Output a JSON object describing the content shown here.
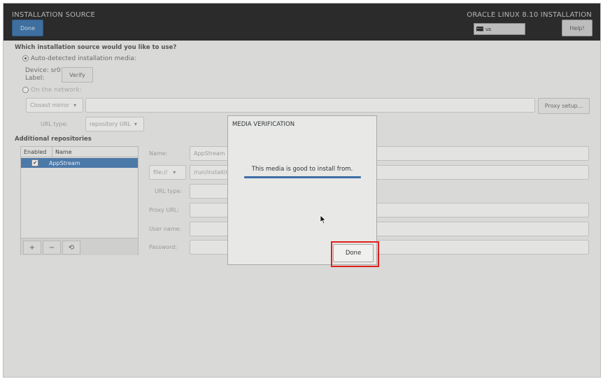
{
  "header": {
    "title": "INSTALLATION SOURCE",
    "product": "ORACLE LINUX 8.10 INSTALLATION",
    "done_label": "Done",
    "help_label": "Help!",
    "keyboard_layout": "us"
  },
  "source": {
    "question": "Which installation source would you like to use?",
    "auto_detected_label": "Auto-detected installation media:",
    "device_label": "Device: sr0",
    "label_label": "Label:",
    "verify_label": "Verify",
    "network_label": "On the network:",
    "mirror_select": "Closest mirror",
    "proxy_setup_label": "Proxy setup...",
    "url_type_label": "URL type:",
    "url_type_select": "repository URL"
  },
  "repos": {
    "section_label": "Additional repositories",
    "columns": [
      "Enabled",
      "Name"
    ],
    "items": [
      {
        "name": "AppStream",
        "enabled": true
      }
    ],
    "form": {
      "name_label": "Name:",
      "name_value": "AppStream",
      "protocol_select": "file://",
      "path_value": "/run/install/r",
      "url_type_label": "URL type:",
      "proxy_url_label": "Proxy URL:",
      "user_name_label": "User name:",
      "password_label": "Password:"
    }
  },
  "dialog": {
    "title": "MEDIA VERIFICATION",
    "message": "This media is good to install from.",
    "progress": 1.0,
    "done_label": "Done"
  },
  "colors": {
    "header_bg": "#2b2b2b",
    "accent": "#3e6f9f",
    "highlight": "#e0201b"
  }
}
